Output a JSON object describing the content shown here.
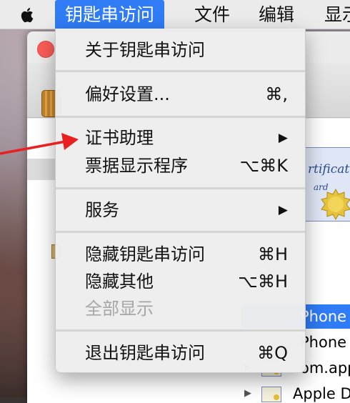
{
  "menubar": {
    "apple_icon": "apple-icon",
    "items": [
      {
        "label": "钥匙串访问",
        "active": true
      },
      {
        "label": "文件",
        "active": false
      },
      {
        "label": "编辑",
        "active": false
      },
      {
        "label": "显示",
        "active": false
      }
    ]
  },
  "dropdown": {
    "about": {
      "label": "关于钥匙串访问"
    },
    "preferences": {
      "label": "偏好设置...",
      "shortcut": "⌘,"
    },
    "certificate_assistant": {
      "label": "证书助理",
      "submenu_glyph": "▶"
    },
    "ticket_viewer": {
      "label": "票据显示程序",
      "shortcut": "⌥⌘K"
    },
    "services": {
      "label": "服务",
      "submenu_glyph": "▶"
    },
    "hide_app": {
      "label": "隐藏钥匙串访问",
      "shortcut": "⌘H"
    },
    "hide_others": {
      "label": "隐藏其他",
      "shortcut": "⌥⌘H"
    },
    "show_all": {
      "label": "全部显示",
      "disabled": true
    },
    "quit": {
      "label": "退出钥匙串访问",
      "shortcut": "⌘Q"
    }
  },
  "window": {
    "cert_preview_text": "rtificate",
    "cert_preview_text2": "ard",
    "list": [
      {
        "label": "Phone",
        "selected": true
      },
      {
        "label": "Phone",
        "selected": false
      },
      {
        "label": "om.app",
        "selected": false
      },
      {
        "label": "Apple D",
        "selected": false
      }
    ]
  },
  "annotation": {
    "arrow_color": "#e82020"
  },
  "colors": {
    "accent": "#2f7cf6",
    "menu_bg": "#eeeeee",
    "close_button": "#fc5d57"
  }
}
